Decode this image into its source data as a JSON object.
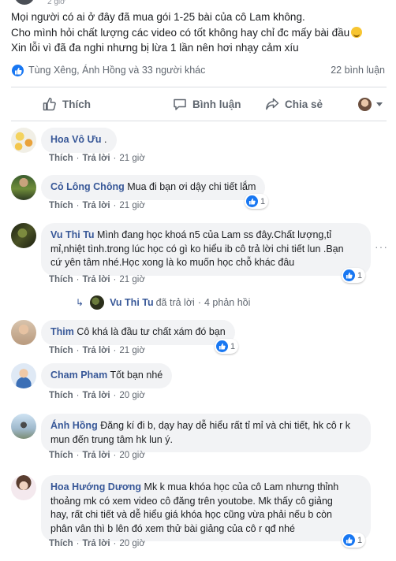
{
  "post": {
    "top_time": "2 giờ",
    "lines": [
      "Mọi người có ai ở đây đã mua gói 1-25 bài của cô Lam không.",
      "Cho mình hỏi chất lượng các video có tốt không hay chỉ đc mấy bài đầu",
      "Xin lỗi vì đã đa nghi nhưng bị lừa 1 lần nên hơi nhạy cảm xíu"
    ],
    "emoji_icon": "grinning-face-emoji"
  },
  "reactions": {
    "names": "Tùng Xêng, Ánh Hồng và 33 người khác",
    "comments_count": "22 bình luận"
  },
  "actions": {
    "like": "Thích",
    "comment": "Bình luận",
    "share": "Chia sẻ"
  },
  "colors": {
    "link": "#385898",
    "bubble": "#f2f3f5",
    "like_blue": "#1877f2",
    "meta_gray": "#606770"
  },
  "comment_actions": {
    "like": "Thích",
    "reply": "Trả lời"
  },
  "comments": [
    {
      "author": "Hoa Vô Ưu",
      "lines": [
        "."
      ],
      "time": "21 giờ"
    },
    {
      "author": "Cỏ Lông Chông",
      "lines": [
        "Mua đi bạn ơi dậy chi tiết lắm"
      ],
      "time": "21 giờ",
      "likes": "1"
    },
    {
      "author": "Vu Thi Tu",
      "lines": [
        "Mình đang học khoá n5 của Lam ss đây.Chất lượng,tỉ",
        "mỉ,nhiệt tình.trong lúc học có gì ko hiểu ib cô trả lời chi tiết lun .Bạn",
        "cứ yên tâm nhé.Học xong là ko muốn học chỗ khác đâu"
      ],
      "time": "21 giờ",
      "likes": "1"
    },
    {
      "author": "Thim",
      "lines": [
        "Cô khá là đầu tư chất xám đó bạn"
      ],
      "time": "21 giờ",
      "likes": "1"
    },
    {
      "author": "Cham Pham",
      "lines": [
        "Tốt bạn nhé"
      ],
      "time": "20 giờ"
    },
    {
      "author": "Ánh Hồng",
      "lines": [
        "Đăng kí đi b, dạy hay dễ hiểu rất tỉ mỉ và chi tiết, hk cô r k",
        "mun đến trung tâm hk lun ý."
      ],
      "time": "20 giờ"
    },
    {
      "author": "Hoa Hướng Dương",
      "lines": [
        "Mk k mua khóa học của cô Lam nhưng thỉnh",
        "thoảng mk có xem video cô đăng trên youtobe. Mk thấy cô giảng",
        "hay, rất chi tiết và dễ hiểu giá khóa học cũng vừa phải nếu b còn",
        "phân vân thì b lên đó xem thử bài giảng của cô r qđ nhé"
      ],
      "time": "20 giờ",
      "likes": "1"
    }
  ],
  "replies": {
    "author": "Vu Thi Tu",
    "text": "đã trả lời",
    "count": "4 phản hồi"
  }
}
